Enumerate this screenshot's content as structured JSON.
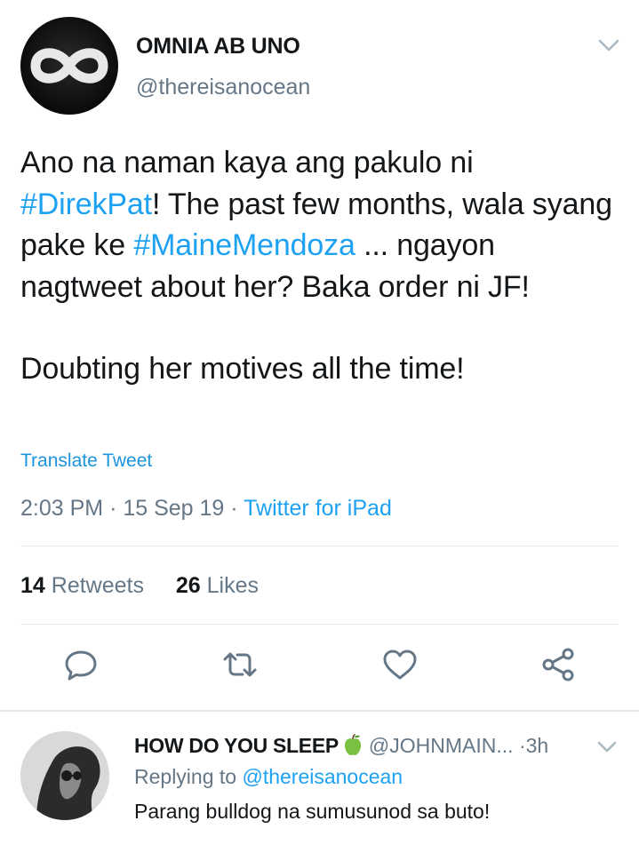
{
  "tweet": {
    "author": {
      "name": "OMNIA AB UNO",
      "handle": "@thereisanocean"
    },
    "text": {
      "p1": [
        "Ano na naman kaya ang pakulo ni ",
        "#DirekPat",
        "! The past few months,  wala syang pake ke ",
        "#MaineMendoza",
        " ... ngayon nagtweet about her?  Baka order ni JF!"
      ],
      "p2": "Doubting her motives all the time!"
    },
    "translate_label": "Translate Tweet",
    "time": "2:03 PM",
    "date": "15 Sep 19",
    "separator": "·",
    "source": "Twitter for iPad",
    "stats": {
      "retweets_count": "14",
      "retweets_label": "Retweets",
      "likes_count": "26",
      "likes_label": "Likes"
    },
    "actions": [
      "reply-icon",
      "retweet-icon",
      "like-icon",
      "share-icon"
    ]
  },
  "reply": {
    "name": "HOW DO YOU SLEEP",
    "handle": "@JOHNMAIN...",
    "separator": "·",
    "time": "3h",
    "replying_prefix": "Replying to",
    "replying_to": "@thereisanocean",
    "text": "Parang bulldog na sumusunod sa buto!"
  },
  "colors": {
    "link": "#1da1f2",
    "secondary_text": "#657786",
    "divider": "#e1e8ed",
    "primary_text": "#14171a"
  }
}
